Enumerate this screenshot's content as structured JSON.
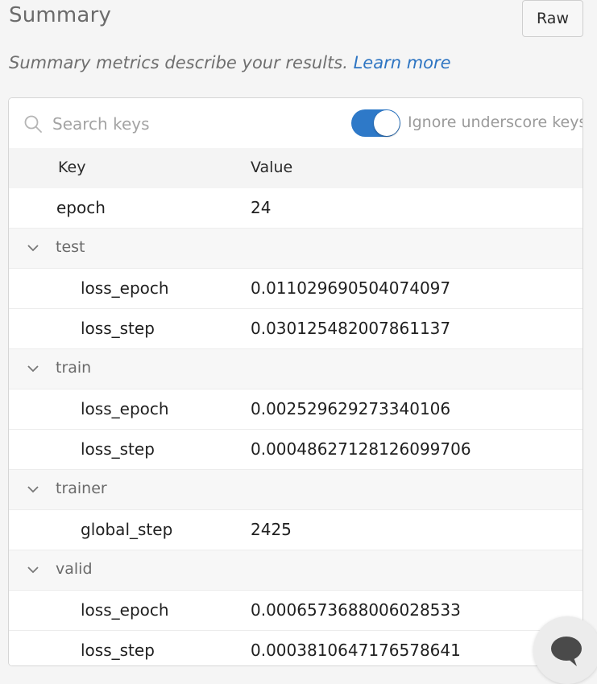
{
  "header": {
    "title": "Summary",
    "raw_label": "Raw",
    "subtitle": "Summary metrics describe your results.",
    "learn_more": "Learn more"
  },
  "search": {
    "placeholder": "Search keys",
    "toggle_label": "Ignore underscore keys",
    "toggle_on": true
  },
  "table": {
    "columns": [
      "Key",
      "Value"
    ],
    "rows": [
      {
        "kind": "top",
        "key": "epoch",
        "value": "24"
      },
      {
        "kind": "group",
        "key": "test"
      },
      {
        "kind": "child",
        "key": "loss_epoch",
        "value": "0.011029690504074097"
      },
      {
        "kind": "child",
        "key": "loss_step",
        "value": "0.030125482007861137"
      },
      {
        "kind": "group",
        "key": "train"
      },
      {
        "kind": "child",
        "key": "loss_epoch",
        "value": "0.002529629273340106"
      },
      {
        "kind": "child",
        "key": "loss_step",
        "value": "0.00048627128126099706"
      },
      {
        "kind": "group",
        "key": "trainer"
      },
      {
        "kind": "child",
        "key": "global_step",
        "value": "2425"
      },
      {
        "kind": "group",
        "key": "valid"
      },
      {
        "kind": "child",
        "key": "loss_epoch",
        "value": "0.0006573688006028533"
      },
      {
        "kind": "child",
        "key": "loss_step",
        "value": "0.0003810647176578641"
      }
    ]
  },
  "icons": {
    "search": "search-icon",
    "chevron": "chevron-down-icon",
    "chat": "chat-bubble-icon"
  },
  "colors": {
    "accent": "#2e79c8",
    "link": "#2e75c2"
  }
}
